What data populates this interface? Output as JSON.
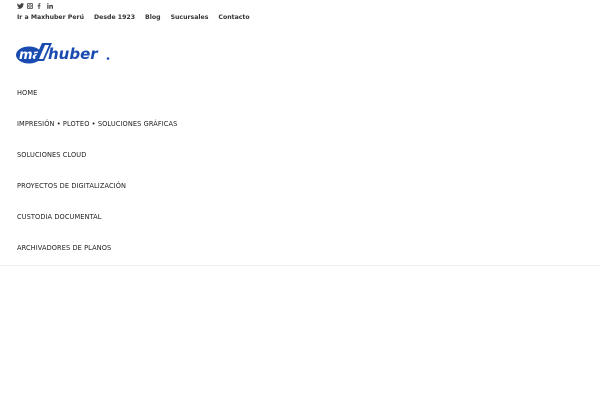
{
  "social": {
    "icons": [
      "twitter-icon",
      "instagram-icon",
      "facebook-icon",
      "linkedin-icon"
    ]
  },
  "top_links": [
    "Ir a Maxhuber Perú",
    "Desde 1923",
    "Blog",
    "Sucursales",
    "Contacto"
  ],
  "logo": {
    "text_max": "max",
    "text_huber": "huber",
    "brand_color": "#1a4bb0",
    "accent_color": "#ffffff"
  },
  "menu": [
    "HOME",
    "IMPRESIÓN • PLOTEO • SOLUCIONES GRÁFICAS",
    "SOLUCIONES CLOUD",
    "PROYECTOS DE DIGITALIZACIÓN",
    "CUSTODIA DOCUMENTAL",
    "ARCHIVADORES DE PLANOS"
  ]
}
